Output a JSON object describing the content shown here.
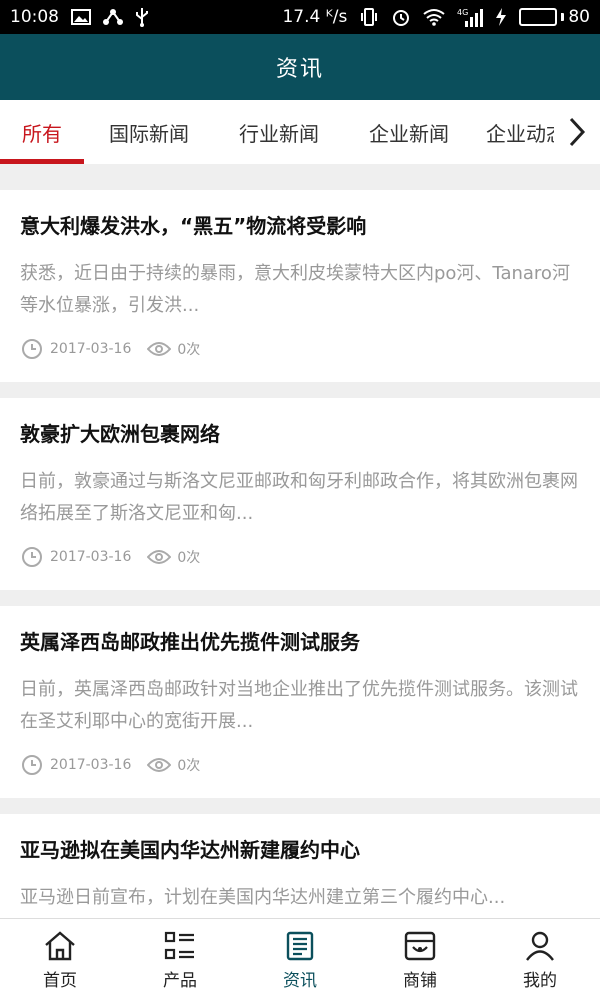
{
  "status_bar": {
    "time": "10:08",
    "speed": "17.4 ᴷ/s",
    "network": "4G",
    "battery": "80",
    "battery_level": 0.8,
    "battery_color": "#4cd31a"
  },
  "header": {
    "title": "资讯",
    "bg_color": "#0b4f5c"
  },
  "tabs": [
    {
      "label": "所有",
      "active": true
    },
    {
      "label": "国际新闻",
      "active": false
    },
    {
      "label": "行业新闻",
      "active": false
    },
    {
      "label": "企业新闻",
      "active": false
    },
    {
      "label": "企业动态",
      "active": false
    }
  ],
  "accent_color": "#c8161d",
  "news": [
    {
      "title": "意大利爆发洪水，“黑五”物流将受影响",
      "summary": "获悉，近日由于持续的暴雨，意大利皮埃蒙特大区内po河、Tanaro河等水位暴涨，引发洪...",
      "date": "2017-03-16",
      "views": "0次"
    },
    {
      "title": "敦豪扩大欧洲包裹网络",
      "summary": "日前，敦豪通过与斯洛文尼亚邮政和匈牙利邮政合作，将其欧洲包裹网络拓展至了斯洛文尼亚和匈...",
      "date": "2017-03-16",
      "views": "0次"
    },
    {
      "title": "英属泽西岛邮政推出优先揽件测试服务",
      "summary": "日前，英属泽西岛邮政针对当地企业推出了优先揽件测试服务。该测试在圣艾利耶中心的宽街开展...",
      "date": "2017-03-16",
      "views": "0次"
    },
    {
      "title": "亚马逊拟在美国内华达州新建履约中心",
      "summary": "亚马逊日前宣布，计划在美国内华达州建立第三个履约中心...",
      "date": "",
      "views": ""
    }
  ],
  "bottom_nav": [
    {
      "label": "首页",
      "icon": "home-icon",
      "active": false
    },
    {
      "label": "产品",
      "icon": "grid-list-icon",
      "active": false
    },
    {
      "label": "资讯",
      "icon": "news-icon",
      "active": true
    },
    {
      "label": "商铺",
      "icon": "shop-icon",
      "active": false
    },
    {
      "label": "我的",
      "icon": "user-icon",
      "active": false
    }
  ]
}
